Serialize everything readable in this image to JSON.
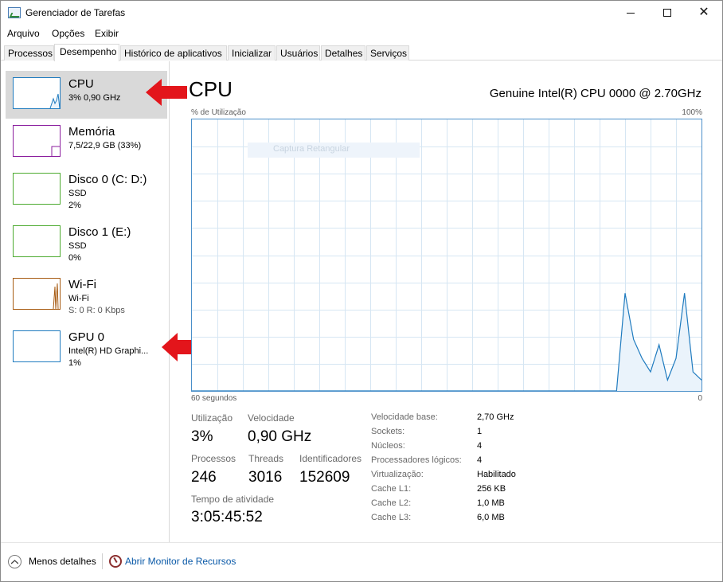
{
  "window": {
    "title": "Gerenciador de Tarefas",
    "close_glyph": "✕"
  },
  "menu": [
    "Arquivo",
    "Opções",
    "Exibir"
  ],
  "tabs": [
    "Processos",
    "Desempenho",
    "Histórico de aplicativos",
    "Inicializar",
    "Usuários",
    "Detalhes",
    "Serviços"
  ],
  "active_tab": "Desempenho",
  "sidebar": {
    "items": [
      {
        "title": "CPU",
        "lines": [
          "3% 0,90 GHz"
        ],
        "color": "#1f7bbf",
        "selected": true
      },
      {
        "title": "Memória",
        "lines": [
          "7,5/22,9 GB (33%)"
        ],
        "color": "#8b1e9e",
        "selected": false
      },
      {
        "title": "Disco 0 (C: D:)",
        "lines": [
          "SSD",
          "2%"
        ],
        "color": "#4caa2f",
        "selected": false
      },
      {
        "title": "Disco 1 (E:)",
        "lines": [
          "SSD",
          "0%"
        ],
        "color": "#4caa2f",
        "selected": false
      },
      {
        "title": "Wi-Fi",
        "lines": [
          "Wi-Fi",
          "S: 0 R: 0 Kbps"
        ],
        "color": "#a75b12",
        "selected": false
      },
      {
        "title": "GPU 0",
        "lines": [
          "Intel(R) HD Graphi...",
          "1%"
        ],
        "color": "#1f7bbf",
        "selected": false
      }
    ]
  },
  "detail": {
    "heading": "CPU",
    "model": "Genuine Intel(R) CPU 0000 @ 2.70GHz",
    "graph_top_left": "% de Utilização",
    "graph_top_right": "100%",
    "graph_bottom_left": "60 segundos",
    "graph_bottom_right": "0",
    "ghost_text": "Captura Retangular",
    "stats": {
      "utilizacao_label": "Utilização",
      "utilizacao_value": "3%",
      "velocidade_label": "Velocidade",
      "velocidade_value": "0,90 GHz",
      "processos_label": "Processos",
      "processos_value": "246",
      "threads_label": "Threads",
      "threads_value": "3016",
      "identificadores_label": "Identificadores",
      "identificadores_value": "152609",
      "tempo_label": "Tempo de atividade",
      "tempo_value": "3:05:45:52"
    },
    "specs": [
      {
        "key": "Velocidade base:",
        "value": "2,70 GHz"
      },
      {
        "key": "Sockets:",
        "value": "1"
      },
      {
        "key": "Núcleos:",
        "value": "4"
      },
      {
        "key": "Processadores lógicos:",
        "value": "4"
      },
      {
        "key": "Virtualização:",
        "value": "Habilitado"
      },
      {
        "key": "Cache L1:",
        "value": "256 KB"
      },
      {
        "key": "Cache L2:",
        "value": "1,0 MB"
      },
      {
        "key": "Cache L3:",
        "value": "6,0 MB"
      }
    ]
  },
  "chart_data": {
    "type": "area",
    "y_range": [
      0,
      100
    ],
    "x_range": [
      60,
      0
    ],
    "grid": true,
    "line_color": "#1f7bbf",
    "fill_color": "#eaf3fb",
    "values": [
      0,
      0,
      0,
      0,
      0,
      0,
      0,
      0,
      0,
      0,
      0,
      0,
      0,
      0,
      0,
      0,
      0,
      0,
      0,
      0,
      0,
      0,
      0,
      0,
      0,
      0,
      0,
      0,
      0,
      0,
      0,
      0,
      0,
      0,
      0,
      0,
      0,
      0,
      0,
      0,
      0,
      0,
      0,
      0,
      0,
      0,
      0,
      0,
      0,
      0,
      0,
      36,
      19,
      12,
      7,
      17,
      4,
      12,
      36,
      7,
      4
    ]
  },
  "footer": {
    "less_details": "Menos detalhes",
    "open_monitor": "Abrir Monitor de Recursos"
  },
  "colors": {
    "annotation_arrow": "#e3151b",
    "selection": "#d9d9d9",
    "graph_border": "#4a8fc9",
    "grid": "#d6e6f3"
  }
}
